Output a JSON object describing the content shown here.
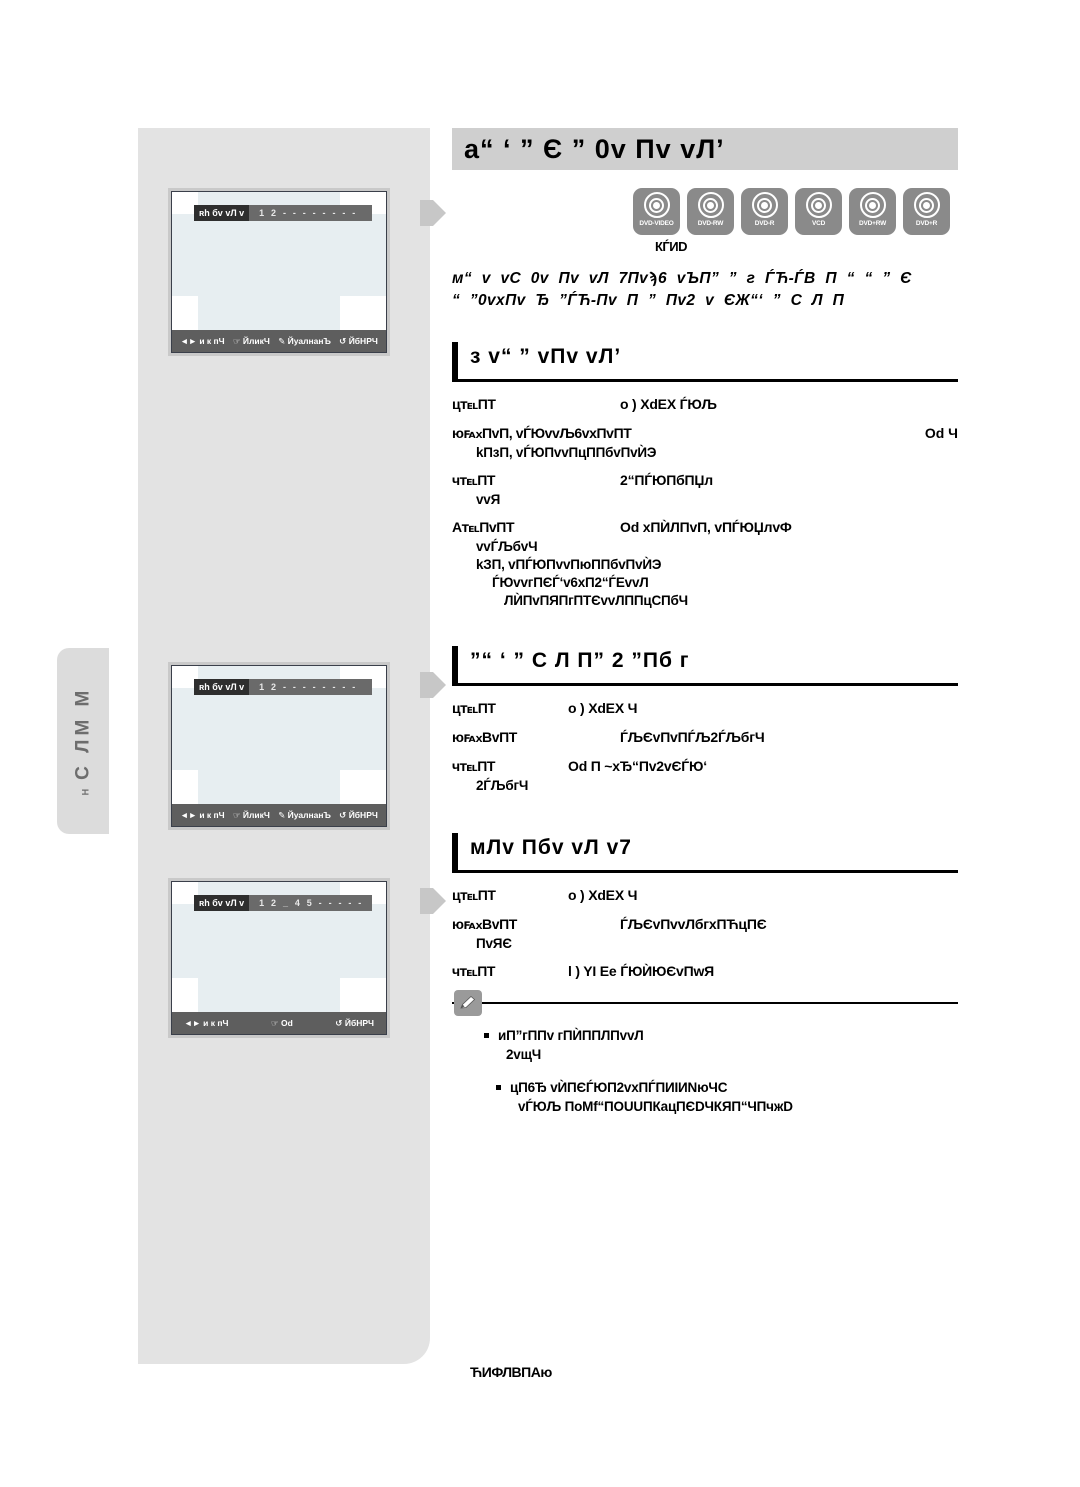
{
  "chapter": {
    "title": "a“ ‘ ” Є ” 0v    Пv  vЛ’"
  },
  "disc_types": [
    {
      "label": "DVD-VIDEO"
    },
    {
      "label": "DVD-RW"
    },
    {
      "label": "DVD-R"
    },
    {
      "label": "VCD"
    },
    {
      "label": "DVD+RW"
    },
    {
      "label": "DVD+R"
    }
  ],
  "disc_caption": "КЃИD",
  "intro": {
    "line1": "м“ v vC  0v   Пv  vЛ  7Пvϡ6  vЪП” ” г  ЃЋ-ЃВ      П “ “  ”    Є",
    "line2": "“ ”0vxПv  Ђ ”ЃЋ-Пv    П ”      Пv2  v ЄЖ“‘ ”  С Л    П"
  },
  "sections": [
    {
      "heading": "з v“   ”   vПv   vЛ’",
      "steps": [
        {
          "num": "ц℡ПТ",
          "text": "o ) XdEX ЃЮЉ",
          "indent": "a",
          "right": "",
          "subs": []
        },
        {
          "num": "ю℻ПvП, vЃЮvvЉ6vxПvПТ",
          "text": "",
          "indent": "b",
          "right": "Od Ч",
          "subs": [
            "kПзП, vЃЮПvvПцППбvПvЍЭ"
          ]
        },
        {
          "num": "ч℡ПТ",
          "text": "2“ПЃЮПбПЏл",
          "indent": "a",
          "right": "",
          "subs": [
            "vvЯ"
          ]
        },
        {
          "num": "A℡ПvПТ",
          "text": "Od xПЍЛПvП, vПЃЮЏлvФ",
          "indent": "a",
          "right": "",
          "subs": [
            "vvЃЉбvЧ",
            "kЗП, vПЃЮПvvПюППбvПvЍЭ",
            "ЃЮvvгПЄЃ‘v6xП2“ЃЕvvЛ",
            "ЛЍПvПЯПгПТЄvvЛППцСПбЧ"
          ]
        }
      ]
    },
    {
      "heading": "”“ ‘ ”   С Л      П”  2    ”Пб    г",
      "steps": [
        {
          "num": "ц℡ПТ",
          "text": "o ) XdEX Ч",
          "indent": "a",
          "right": "",
          "subs": []
        },
        {
          "num": "ю℻ВvПТ",
          "text": "ЃЉЄvПvПЃЉ2ЃЉбгЧ",
          "indent": "b",
          "right": "",
          "subs": []
        },
        {
          "num": "ч℡ПТ",
          "text": "Od П    ~xЂ“Пv2vЄЃЮ‘",
          "indent": "a",
          "right": "",
          "subs": [
            "2ЃЉбгЧ"
          ]
        }
      ]
    },
    {
      "heading": "мЛv          Пбv   vЛ v7",
      "steps": [
        {
          "num": "ц℡ПТ",
          "text": "o ) XdEX Ч",
          "indent": "a",
          "right": "",
          "subs": []
        },
        {
          "num": "ю℻ВvПТ",
          "text": "ЃЉЄvПvvЛбгxПЋцПЄ",
          "indent": "b",
          "right": "",
          "subs": [
            "ПvЯЄ"
          ]
        },
        {
          "num": "ч℡ПТ",
          "text": "l ) YI Ee ЃЮЍЮЄvПwЯ",
          "indent": "a",
          "right": "",
          "subs": []
        }
      ]
    }
  ],
  "notes": [
    {
      "line1": "иП”гППv гПЍППЛПvvЛ",
      "line2": "2vщЧ"
    },
    {
      "line1": "цП6Ђ vЍПЄЃЮП2vxПЃПИIИNюЧС",
      "line2": "vЃЮЉ ПоМf“ПОUUПКацПЄDЧКЯП“ЧПчжD"
    }
  ],
  "screens": [
    {
      "name": "screen-1",
      "menu_label": "ʀһ бv  vЛ v",
      "numbers": "1 2 - - - - - - - -",
      "numbers_underlined": "2",
      "bottom_items": [
        "◄► и к пЧ",
        "☞ ЙликЧ",
        "✎ ЙуалнанЪ",
        "↺ ЙбНPЧ"
      ]
    },
    {
      "name": "screen-2",
      "menu_label": "ʀһ бv  vЛ v",
      "numbers": "1 2 - - - - - - - -",
      "numbers_underlined": "2",
      "bottom_items": [
        "◄► и к пЧ",
        "☞ ЙликЧ",
        "✎ ЙуалнанЪ",
        "↺ ЙбНPЧ"
      ]
    },
    {
      "name": "screen-3",
      "menu_label": "ʀһ бv  vЛ v",
      "numbers": "1 2 _ 4 5 - - - - -",
      "numbers_underlined": "_",
      "bottom_items": [
        "◄► и к пЧ",
        "☞ Od",
        "↺ ЙбНPЧ"
      ]
    }
  ],
  "side_tab": {
    "main_text": "С ЛМ М",
    "sub_text": "Н"
  },
  "footer": "ЋИФЛВПАю",
  "colors": {
    "page_panel": "#e3e3e3",
    "chapter_bar": "#cfcfcf",
    "disc_icon": "#8a8a8a",
    "screen_frame": "#c9c9c9",
    "screen_body": "#e7eef1",
    "screen_topbar": "#6a6a6a",
    "screen_botbar": "#5e5e5e",
    "side_tab": "#dcdcdc"
  }
}
